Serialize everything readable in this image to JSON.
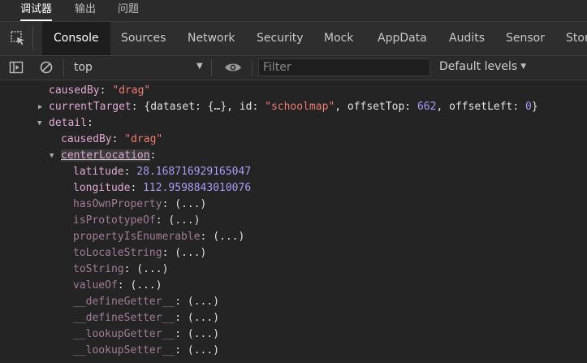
{
  "panel_tabs": [
    "调试器",
    "输出",
    "问题"
  ],
  "devtools_tabs": [
    "Console",
    "Sources",
    "Network",
    "Security",
    "Mock",
    "AppData",
    "Audits",
    "Sensor",
    "Stor"
  ],
  "filterbar": {
    "context": "top",
    "filter_placeholder": "Filter",
    "levels": "Default levels"
  },
  "console": {
    "causedBy_key": "causedBy",
    "causedBy_value": "\"drag\"",
    "currentTarget_key": "currentTarget",
    "currentTarget_preview": {
      "open": "{dataset: {…}, id: ",
      "id_value": "\"schoolmap\"",
      "mid": ", offsetTop: ",
      "offsetTop": "662",
      "mid2": ", offsetLeft: ",
      "offsetLeft": "0",
      "close": "}"
    },
    "detail_key": "detail",
    "detail_causedBy_key": "causedBy",
    "detail_causedBy_value": "\"drag\"",
    "centerLocation_key": "centerLocation",
    "latitude_key": "latitude",
    "latitude_value": "28.168716929165047",
    "longitude_key": "longitude",
    "longitude_value": "112.9598843010076",
    "accessor_value": "(...)",
    "proto_methods": [
      "hasOwnProperty",
      "isPrototypeOf",
      "propertyIsEnumerable",
      "toLocaleString",
      "toString",
      "valueOf",
      "__defineGetter__",
      "__defineSetter__",
      "__lookupGetter__",
      "__lookupSetter__"
    ]
  }
}
